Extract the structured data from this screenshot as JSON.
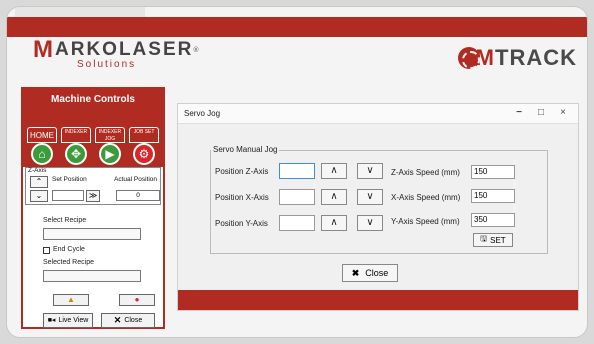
{
  "brand": {
    "logo_main": "ARKOLASER",
    "logo_m": "M",
    "logo_reg": "®",
    "logo_sub": "Solutions",
    "product_m": "M",
    "product_rest": "TRACK",
    "accent": "#b02b22"
  },
  "machine_controls": {
    "title": "Machine Controls",
    "modes": [
      {
        "label": "HOME",
        "icon": "house-icon"
      },
      {
        "label": "INDEXER",
        "icon": "crosshair-icon"
      },
      {
        "label": "INDEXER JOG",
        "icon": "play-icon"
      },
      {
        "label": "JOB SET",
        "icon": "gear-icon"
      }
    ],
    "zaxis": {
      "legend": "Z-Axis",
      "set_position_label": "Set Position",
      "actual_position_label": "Actual Position",
      "set_value": "",
      "actual_value": "0",
      "up": "⌃",
      "down": "⌄",
      "go": "≫"
    },
    "select_recipe_label": "Select Recipe",
    "select_recipe_value": "",
    "end_cycle_label": "End Cycle",
    "selected_recipe_label": "Selected Recipe",
    "selected_recipe_value": "",
    "live_view_label": "Live View",
    "close_label": "Close"
  },
  "servo_jog": {
    "window_title": "Servo Jog",
    "minimize": "−",
    "maximize": "□",
    "close_x": "×",
    "group_title": "Servo Manual Jog",
    "rows": [
      {
        "pos_label": "Position Z-Axis",
        "speed_label": "Z-Axis Speed (mm)",
        "speed_value": "150",
        "pos_value": ""
      },
      {
        "pos_label": "Position X-Axis",
        "speed_label": "X-Axis Speed (mm)",
        "speed_value": "150",
        "pos_value": ""
      },
      {
        "pos_label": "Position Y-Axis",
        "speed_label": "Y-Axis Speed (mm)",
        "speed_value": "350",
        "pos_value": ""
      }
    ],
    "up_arrow": "∧",
    "down_arrow": "∨",
    "set_label": "SET",
    "close_label": "Close"
  }
}
